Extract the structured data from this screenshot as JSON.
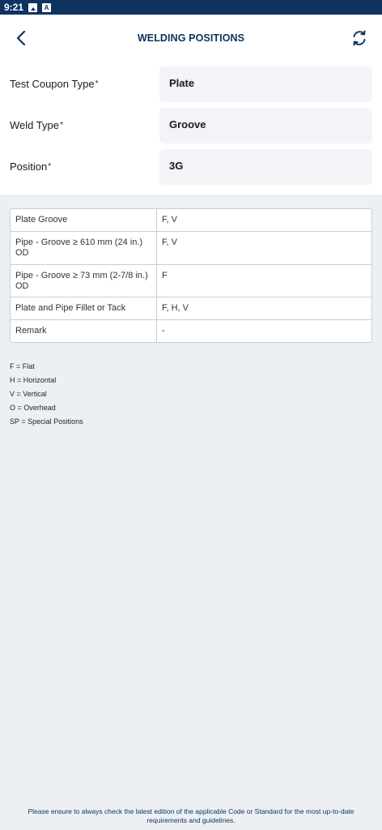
{
  "status_bar": {
    "time": "9:21"
  },
  "header": {
    "title": "WELDING POSITIONS"
  },
  "form": {
    "required_marker": "*",
    "fields": [
      {
        "label": "Test Coupon Type",
        "value": "Plate"
      },
      {
        "label": "Weld Type",
        "value": "Groove"
      },
      {
        "label": "Position",
        "value": "3G"
      }
    ]
  },
  "table": {
    "rows": [
      {
        "label": "Plate Groove",
        "value": "F, V"
      },
      {
        "label": "Pipe - Groove ≥ 610 mm (24 in.) OD",
        "value": "F, V"
      },
      {
        "label": "Pipe - Groove ≥ 73 mm (2-7/8 in.) OD",
        "value": "F"
      },
      {
        "label": "Plate and Pipe Fillet or Tack",
        "value": "F, H, V"
      },
      {
        "label": "Remark",
        "value": "-"
      }
    ]
  },
  "legend": [
    "F = Flat",
    "H = Horizontal",
    "V = Vertical",
    "O = Overhead",
    "SP = Special Positions"
  ],
  "footer": {
    "note": "Please ensure to always check the latest edition of the applicable Code or Standard for the most up-to-date requirements and guidelines."
  },
  "colors": {
    "brand": "#0f3361",
    "field_bg": "#f2f4f8",
    "page_bg": "#edf0f3"
  }
}
